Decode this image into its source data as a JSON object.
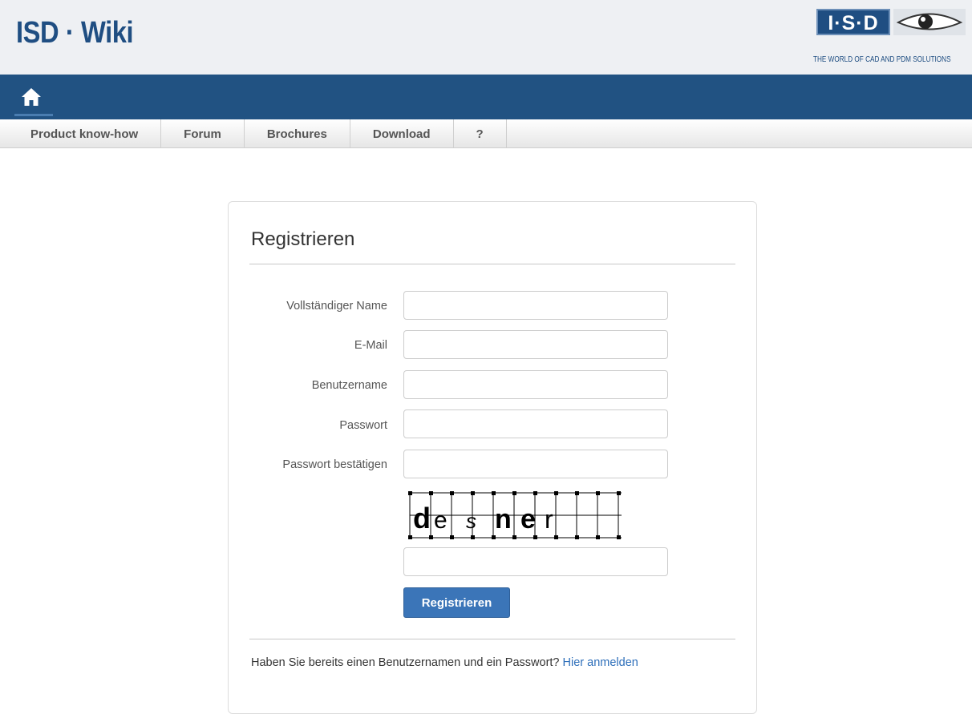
{
  "header": {
    "site_title": "ISD · Wiki",
    "logo_text": "I·S·D",
    "logo_tagline": "THE WORLD OF CAD AND PDM SOLUTIONS"
  },
  "nav": {
    "home_icon": "home-icon",
    "tabs": [
      {
        "label": "Product know-how"
      },
      {
        "label": "Forum"
      },
      {
        "label": "Brochures"
      },
      {
        "label": "Download"
      },
      {
        "label": "?"
      }
    ]
  },
  "form": {
    "title": "Registrieren",
    "fields": [
      {
        "label": "Vollständiger Name",
        "value": ""
      },
      {
        "label": "E-Mail",
        "value": ""
      },
      {
        "label": "Benutzername",
        "value": ""
      },
      {
        "label": "Passwort",
        "value": ""
      },
      {
        "label": "Passwort bestätigen",
        "value": ""
      }
    ],
    "captcha_text": "desner",
    "captcha_value": "",
    "submit_label": "Registrieren",
    "footer_text": "Haben Sie bereits einen Benutzernamen und ein Passwort?",
    "footer_link": "Hier anmelden"
  },
  "colors": {
    "brand_blue": "#215282",
    "button_blue": "#3b75b8",
    "link_blue": "#2e6fba"
  }
}
